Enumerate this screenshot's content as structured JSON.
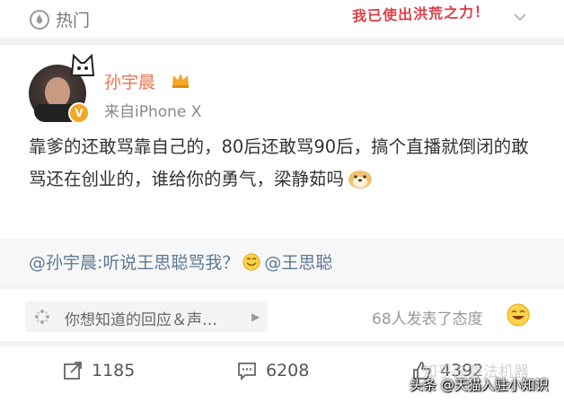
{
  "header": {
    "hot_label": "热门",
    "sticker_text": "我已使出洪荒之力！"
  },
  "post": {
    "username": "孙宇晨",
    "source": "来自iPhone X",
    "content": "靠爹的还敢骂靠自己的，80后还敢骂90后，搞个直播就倒闭的敢骂还在创业的，谁给你的勇气，梁静茹吗"
  },
  "repost": {
    "mention": "@孙宇晨",
    "text": ":听说王思聪骂我？",
    "target": "@王思聪"
  },
  "suggestion": {
    "text": "你想知道的回应＆声…",
    "attitude_count": "68人发表了态度"
  },
  "actions": {
    "repost_count": "1185",
    "comment_count": "6208",
    "like_count": "4392"
  },
  "overlay": {
    "watermark": "知乎@算法机器",
    "credit": "头条 @天猫入驻小知识"
  },
  "colors": {
    "username": "#eb7350",
    "link": "#5d7895",
    "badge": "#f5a623"
  }
}
